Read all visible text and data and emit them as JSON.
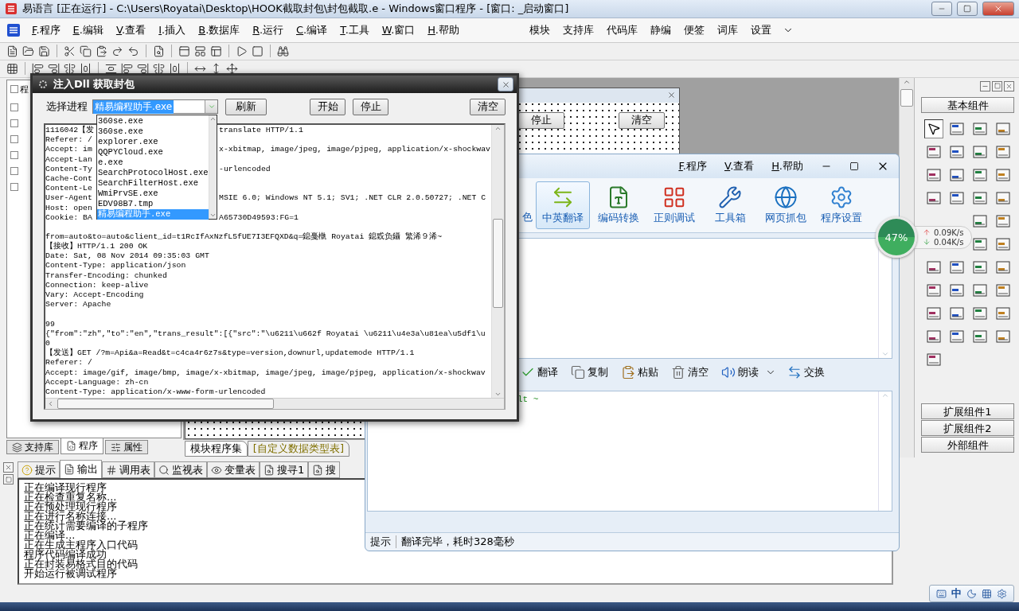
{
  "main_window": {
    "title": "易语言 [正在运行] - C:\\Users\\Royatai\\Desktop\\HOOK截取封包\\封包截取.e - Windows窗口程序 - [窗口: _启动窗口]",
    "menu": [
      "F.程序",
      "E.编辑",
      "V.查看",
      "I.插入",
      "B.数据库",
      "R.运行",
      "C.编译",
      "T.工具",
      "W.窗口",
      "H.帮助"
    ],
    "menu_right": [
      "模块",
      "支持库",
      "代码库",
      "静编",
      "便签",
      "词库",
      "设置"
    ]
  },
  "left_panel": {
    "tree_root": "程",
    "tabs": [
      {
        "label": "支持库",
        "selected": false
      },
      {
        "label": "程序",
        "selected": true
      },
      {
        "label": "属性",
        "selected": false
      }
    ]
  },
  "designer": {
    "buttons": [
      "停止",
      "清空"
    ]
  },
  "editor_tabs": [
    {
      "label": "模块程序集",
      "selected": true
    },
    {
      "label": "[自定义数据类型表]",
      "selected": false
    }
  ],
  "palette": {
    "header": "基本组件",
    "footer": [
      "扩展组件1",
      "扩展组件2",
      "外部组件"
    ]
  },
  "output": {
    "tabs": [
      {
        "label": "提示",
        "selected": false
      },
      {
        "label": "输出",
        "selected": true
      },
      {
        "label": "调用表",
        "selected": false
      },
      {
        "label": "监视表",
        "selected": false
      },
      {
        "label": "变量表",
        "selected": false
      },
      {
        "label": "搜寻1",
        "selected": false
      },
      {
        "label": "搜",
        "selected": false
      }
    ],
    "lines": [
      "正在编译现行程序",
      "正在检查重复名称...",
      "正在预处理现行程序",
      "正在进行名称连接...",
      "正在统计需要编译的子程序",
      "正在编译...",
      "正在生成主程序入口代码",
      "程序代码编译成功",
      "正在封装易格式目的代码",
      "开始运行被调试程序"
    ]
  },
  "tray": {
    "ime": "中"
  },
  "translator": {
    "menu": [
      "F.程序",
      "V.查看",
      "H.帮助"
    ],
    "cut_label": "色",
    "tools": [
      {
        "label": "中英翻译",
        "selected": true
      },
      {
        "label": "编码转换",
        "selected": false
      },
      {
        "label": "正则调试",
        "selected": false
      },
      {
        "label": "工具箱",
        "selected": false
      },
      {
        "label": "网页抓包",
        "selected": false
      },
      {
        "label": "程序设置",
        "selected": false
      }
    ],
    "actions": [
      {
        "label": "翻译",
        "has_menu": false
      },
      {
        "label": "复制",
        "has_menu": false
      },
      {
        "label": "粘贴",
        "has_menu": false
      },
      {
        "label": "清空",
        "has_menu": false
      },
      {
        "label": "朗读",
        "has_menu": true
      },
      {
        "label": "交换",
        "has_menu": false
      }
    ],
    "output_text": "lt ~",
    "status_label": "提示",
    "status": "翻译完毕，耗时328毫秒"
  },
  "net_monitor": {
    "load": "47%",
    "up": "0.09K/s",
    "down": "0.04K/s"
  },
  "inject_dialog": {
    "title": "注入Dll 获取封包",
    "process_label": "选择进程",
    "process_value": "精易编程助手.exe",
    "buttons": [
      "刷新",
      "开始",
      "停止",
      "清空"
    ],
    "process_list": [
      {
        "label": "360se.exe",
        "selected": false
      },
      {
        "label": "360se.exe",
        "selected": false
      },
      {
        "label": "explorer.exe",
        "selected": false
      },
      {
        "label": "QQPYCloud.exe",
        "selected": false
      },
      {
        "label": "e.exe",
        "selected": false
      },
      {
        "label": "SearchProtocolHost.exe",
        "selected": false
      },
      {
        "label": "SearchFilterHost.exe",
        "selected": false
      },
      {
        "label": "WmiPrvSE.exe",
        "selected": false
      },
      {
        "label": "EDV98B7.tmp",
        "selected": false
      },
      {
        "label": "精易编程助手.exe",
        "selected": true
      }
    ],
    "log": [
      [
        {
          "left": "1116042【发",
          "right": "translate HTTP/1.1"
        },
        {
          "left": "Referer: /"
        },
        {
          "left": "Accept: im",
          "right": "x-xbitmap, image/jpeg, image/pjpeg, application/x-shockwav"
        },
        {
          "left": "Accept-Lan"
        },
        {
          "left": "Content-Ty",
          "right": "-urlencoded"
        },
        {
          "left": "Cache-Cont"
        },
        {
          "left": "Content-Le"
        },
        {
          "left": "User-Agent",
          "right": "MSIE 6.0; Windows NT 5.1; SV1; .NET CLR 2.0.50727; .NET C"
        },
        {
          "left": "Host: open"
        },
        {
          "left": "Cookie: BA",
          "right": "A65730D49593:FG=1"
        }
      ],
      [
        {
          "text": "from=auto&to=auto&client_id=t1RcIfAxNzfL5fUE7I3EFQXD&q=鎴戞槸 Royatai 鎴戜负鑷  繁浠９浠~"
        },
        {
          "text": "【接收】HTTP/1.1 200 OK"
        },
        {
          "text": "Date: Sat, 08 Nov 2014 09:35:03 GMT"
        },
        {
          "text": "Content-Type: application/json"
        },
        {
          "text": "Transfer-Encoding: chunked"
        },
        {
          "text": "Connection: keep-alive"
        },
        {
          "text": "Vary: Accept-Encoding"
        },
        {
          "text": "Server: Apache"
        }
      ],
      [
        {
          "text": "99"
        },
        {
          "text": "{\"from\":\"zh\",\"to\":\"en\",\"trans_result\":[{\"src\":\"\\u6211\\u662f Royatai \\u6211\\u4e3a\\u81ea\\u5df1\\u"
        },
        {
          "text": "0"
        },
        {
          "text": "【发送】GET /?m=Api&a=Read&t=c4ca4r6z7s&type=version,downurl,updatemode HTTP/1.1"
        },
        {
          "text": "Referer: /"
        },
        {
          "text": "Accept: image/gif, image/bmp, image/x-xbitmap, image/jpeg, image/pjpeg, application/x-shockwav"
        },
        {
          "text": "Accept-Language: zh-cn"
        },
        {
          "text": "Content-Type: application/x-www-form-urlencoded"
        }
      ]
    ]
  }
}
